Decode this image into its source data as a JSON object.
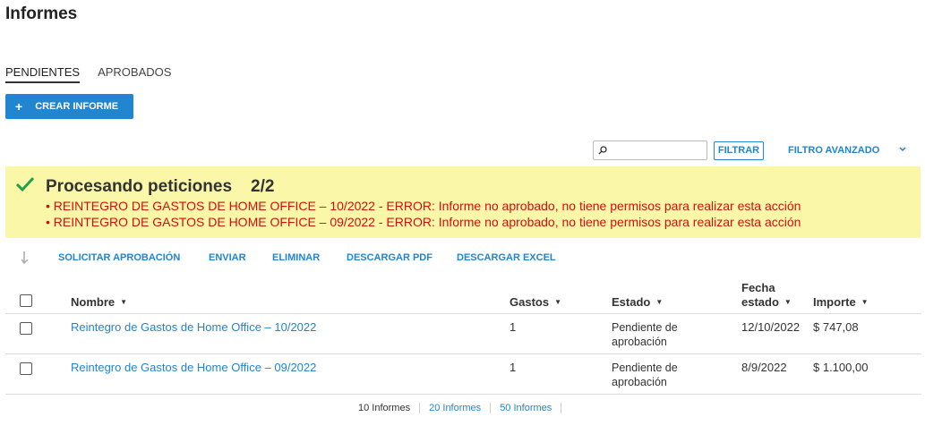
{
  "page": {
    "title": "Informes"
  },
  "tabs": [
    {
      "label": "PENDIENTES",
      "active": true
    },
    {
      "label": "APROBADOS",
      "active": false
    }
  ],
  "toolbar": {
    "create_label": "CREAR INFORME",
    "search_placeholder": "",
    "search_value": "",
    "filter_label": "FILTRAR",
    "advanced_filter_label": "FILTRO AVANZADO"
  },
  "banner": {
    "icon": "check-icon",
    "title": "Procesando peticiones",
    "count": "2/2",
    "errors": [
      "• REINTEGRO DE GASTOS DE HOME OFFICE – 10/2022 - ERROR: Informe no aprobado, no tiene permisos para realizar esta acción",
      "• REINTEGRO DE GASTOS DE HOME OFFICE – 09/2022 - ERROR: Informe no aprobado, no tiene permisos para realizar esta acción"
    ],
    "colors": {
      "background": "#fbf7a8",
      "error_text": "#d01010",
      "check": "#21a04a"
    }
  },
  "actions": {
    "request_approval": "SOLICITAR APROBACIÓN",
    "send": "ENVIAR",
    "delete": "ELIMINAR",
    "download_pdf": "DESCARGAR PDF",
    "download_excel": "DESCARGAR EXCEL"
  },
  "table": {
    "columns": {
      "name": "Nombre",
      "expenses": "Gastos",
      "status": "Estado",
      "status_date_1": "Fecha",
      "status_date_2": "estado",
      "amount": "Importe"
    },
    "rows": [
      {
        "name": "Reintegro de Gastos de Home Office – 10/2022",
        "expenses": "1",
        "status": "Pendiente de aprobación",
        "date": "12/10/2022",
        "amount": "$ 747,08"
      },
      {
        "name": "Reintegro de Gastos de Home Office – 09/2022",
        "expenses": "1",
        "status": "Pendiente de aprobación",
        "date": "8/9/2022",
        "amount": "$ 1.100,00"
      }
    ]
  },
  "pager": {
    "options": [
      "10 Informes",
      "20 Informes",
      "50 Informes"
    ],
    "selected": "10 Informes"
  },
  "colors": {
    "accent": "#2185d0"
  }
}
